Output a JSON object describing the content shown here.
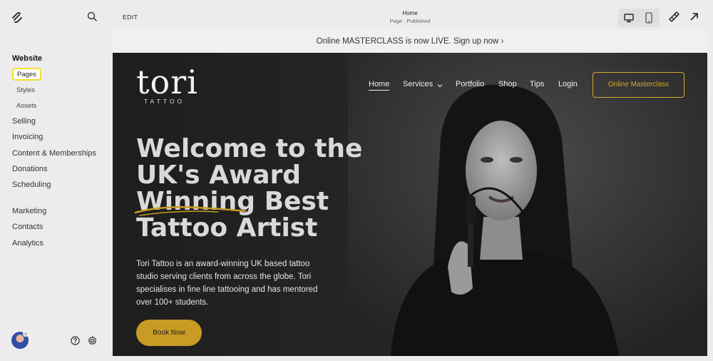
{
  "sidebar": {
    "logo_icon": "squarespace-logo-icon",
    "search_icon": "search-icon",
    "items": [
      {
        "label": "Website"
      },
      {
        "label": "Pages"
      },
      {
        "label": "Styles"
      },
      {
        "label": "Assets"
      },
      {
        "label": "Selling"
      },
      {
        "label": "Invoicing"
      },
      {
        "label": "Content & Memberships"
      },
      {
        "label": "Donations"
      },
      {
        "label": "Scheduling"
      },
      {
        "label": "Marketing"
      },
      {
        "label": "Contacts"
      },
      {
        "label": "Analytics"
      }
    ],
    "highlight_color": "#f2df2a"
  },
  "topbar": {
    "edit_label": "EDIT",
    "page_title": "Home",
    "page_status": "Page · Published"
  },
  "announcement": "Online MASTERCLASS is now LIVE. Sign up now ›",
  "site": {
    "brand": "tori",
    "brand_sub": "TATTOO",
    "menu": [
      {
        "label": "Home"
      },
      {
        "label": "Services"
      },
      {
        "label": "Portfolio"
      },
      {
        "label": "Shop"
      },
      {
        "label": "Tips"
      },
      {
        "label": "Login"
      }
    ],
    "cta": "Online Masterclass",
    "headline": [
      "Welcome to the",
      "UK's Award",
      "Winning Best",
      "Tattoo Artist"
    ],
    "body": "Tori Tattoo is an award-winning UK based tattoo studio serving clients from across the globe. Tori specialises in fine line tattooing and has mentored over 100+ students.",
    "book_button": "Book Now",
    "accent_color": "#c79b24"
  }
}
